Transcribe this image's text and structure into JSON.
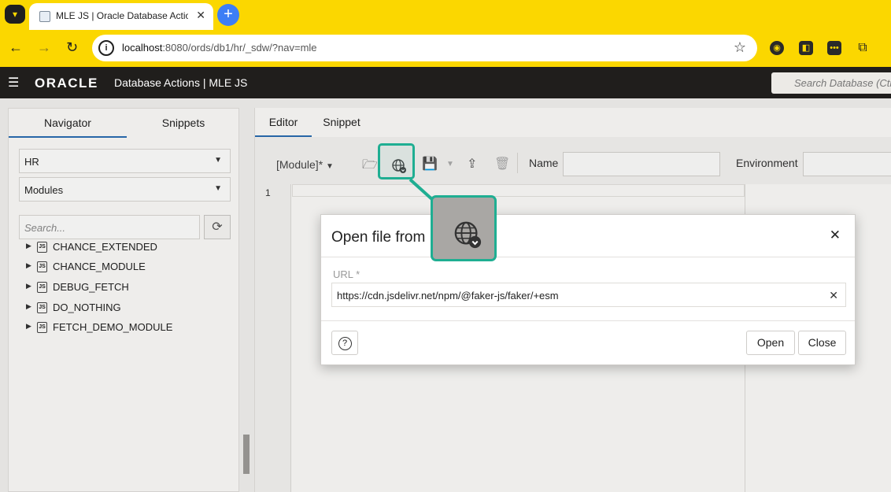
{
  "browser": {
    "tab_title": "MLE JS | Oracle Database Actions",
    "tab_close": "✕",
    "new_tab": "+",
    "url_host": "localhost",
    "url_rest": ":8080/ords/db1/hr/_sdw/?nav=mle"
  },
  "app": {
    "logo": "ORACLE",
    "title": "Database Actions |  MLE JS",
    "search_placeholder": "Search Database (Ctrl+K)"
  },
  "navigator": {
    "tabs": [
      "Navigator",
      "Snippets"
    ],
    "schema": "HR",
    "object_type": "Modules",
    "search_placeholder": "Search...",
    "items": [
      "CHANCE_EXTENDED",
      "CHANCE_MODULE",
      "DEBUG_FETCH",
      "DO_NOTHING",
      "FETCH_DEMO_MODULE"
    ]
  },
  "editor": {
    "tabs": [
      "Editor",
      "Snippet"
    ],
    "module_dropdown": "[Module]*",
    "name_label": "Name",
    "environment_label": "Environment",
    "line_number": "1"
  },
  "dialog": {
    "title": "Open file from",
    "url_label": "URL *",
    "url_value": "https://cdn.jsdelivr.net/npm/@faker-js/faker/+esm",
    "help": "?",
    "open_button": "Open",
    "close_button": "Close"
  },
  "colors": {
    "browser_accent": "#fbd700",
    "header_bg": "#201e1c",
    "highlight": "#1fae92",
    "tab_underline": "#2a6cb0"
  }
}
